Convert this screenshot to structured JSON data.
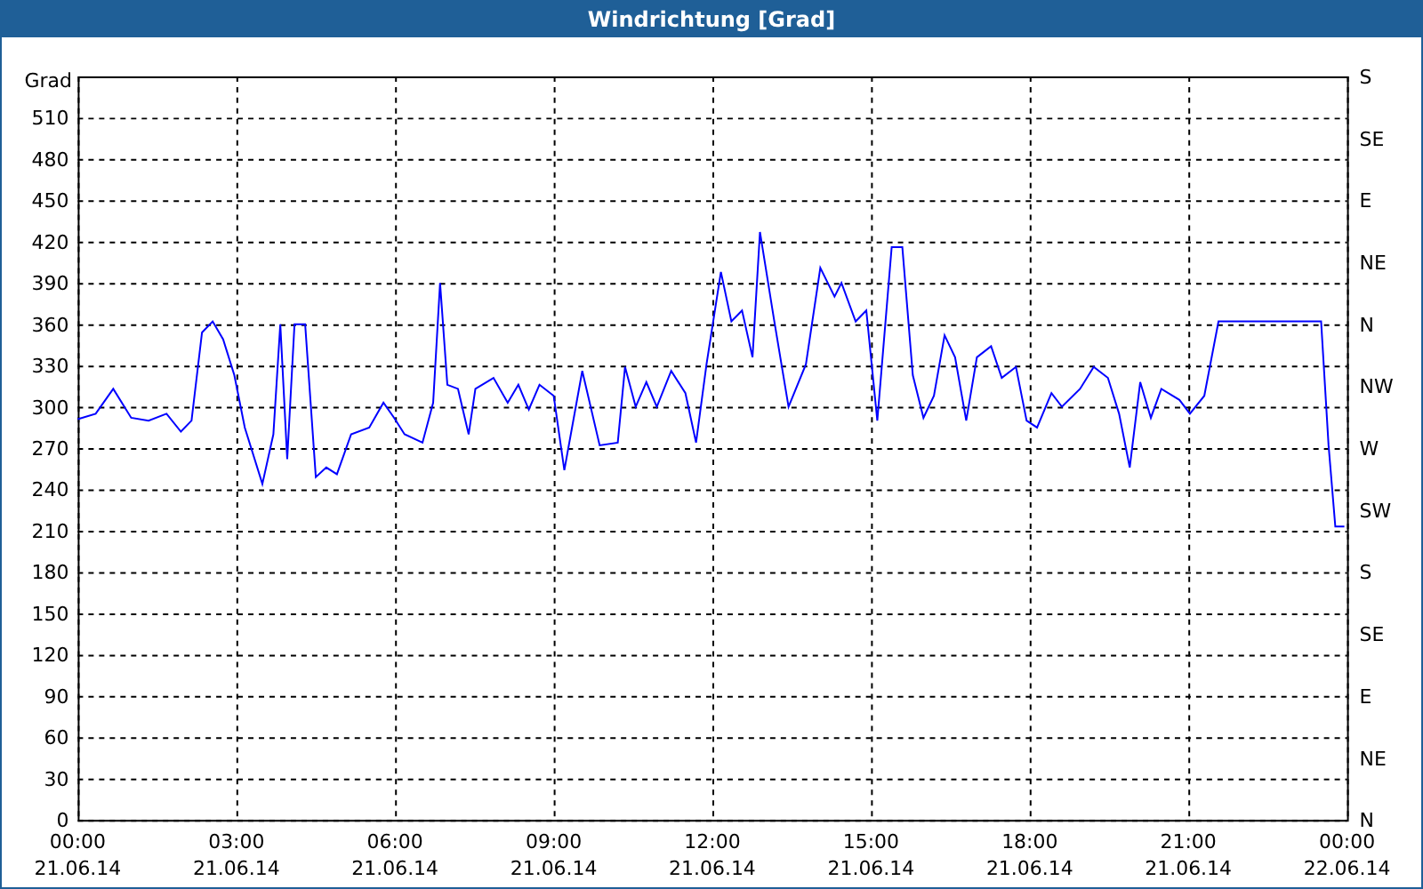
{
  "chart": {
    "chart_data": {
      "type": "line",
      "title": "Windrichtung [Grad]",
      "ylabel": "Grad",
      "x": [
        0,
        0.34,
        0.67,
        1.01,
        1.34,
        1.68,
        1.95,
        2.15,
        2.35,
        2.55,
        2.75,
        2.96,
        3.16,
        3.49,
        3.7,
        3.83,
        3.96,
        4.1,
        4.3,
        4.5,
        4.7,
        4.9,
        5.17,
        5.51,
        5.78,
        5.98,
        6.18,
        6.52,
        6.72,
        6.85,
        6.99,
        7.19,
        7.39,
        7.52,
        7.86,
        8.13,
        8.33,
        8.53,
        8.73,
        9.0,
        9.2,
        9.54,
        9.87,
        10.21,
        10.35,
        10.55,
        10.75,
        10.95,
        11.22,
        11.49,
        11.69,
        11.89,
        12.16,
        12.36,
        12.56,
        12.76,
        12.9,
        13.17,
        13.44,
        13.77,
        14.04,
        14.31,
        14.44,
        14.71,
        14.91,
        15.12,
        15.39,
        15.59,
        15.79,
        15.99,
        16.19,
        16.39,
        16.59,
        16.8,
        17.0,
        17.27,
        17.47,
        17.74,
        17.94,
        18.14,
        18.41,
        18.61,
        18.95,
        19.21,
        19.48,
        19.69,
        19.89,
        20.09,
        20.29,
        20.49,
        20.83,
        21.03,
        21.3,
        21.57,
        23.51,
        23.65,
        23.78,
        23.95
      ],
      "grid": true,
      "series": [
        {
          "color": "#0000ff",
          "values": [
            291,
            295,
            313,
            292,
            290,
            295,
            282,
            290,
            354,
            362,
            349,
            323,
            285,
            244,
            280,
            360,
            262,
            360,
            360,
            249,
            256,
            251,
            280,
            285,
            303,
            292,
            280,
            274,
            303,
            390,
            316,
            313,
            280,
            313,
            321,
            303,
            316,
            298,
            316,
            308,
            254,
            326,
            272,
            274,
            329,
            300,
            318,
            300,
            326,
            310,
            274,
            331,
            398,
            362,
            370,
            336,
            427,
            362,
            300,
            331,
            401,
            380,
            390,
            362,
            370,
            290,
            416,
            416,
            323,
            292,
            308,
            352,
            336,
            290,
            336,
            344,
            321,
            329,
            290,
            285,
            310,
            300,
            313,
            329,
            321,
            295,
            256,
            318,
            292,
            313,
            305,
            295,
            308,
            362,
            362,
            272,
            213,
            213
          ]
        }
      ],
      "xlim": [
        0,
        24
      ],
      "ylim": [
        0,
        540
      ],
      "xticks": [
        {
          "value": 0,
          "label": "00:00"
        },
        {
          "value": 3,
          "label": "03:00"
        },
        {
          "value": 6,
          "label": "06:00"
        },
        {
          "value": 9,
          "label": "09:00"
        },
        {
          "value": 12,
          "label": "12:00"
        },
        {
          "value": 15,
          "label": "15:00"
        },
        {
          "value": 18,
          "label": "18:00"
        },
        {
          "value": 21,
          "label": "21:00"
        },
        {
          "value": 24,
          "label": "00:00"
        }
      ],
      "yticks": [
        0,
        30,
        60,
        90,
        120,
        150,
        180,
        210,
        240,
        270,
        300,
        330,
        360,
        390,
        420,
        450,
        480,
        510
      ]
    },
    "x_tick_dates": [
      "21.06.14",
      "21.06.14",
      "21.06.14",
      "21.06.14",
      "21.06.14",
      "21.06.14",
      "21.06.14",
      "21.06.14",
      "22.06.14"
    ],
    "right_axis_labels": [
      "S",
      "SE",
      "E",
      "NE",
      "N",
      "NW",
      "W",
      "SW",
      "S",
      "SE",
      "E",
      "NE",
      "N"
    ]
  }
}
